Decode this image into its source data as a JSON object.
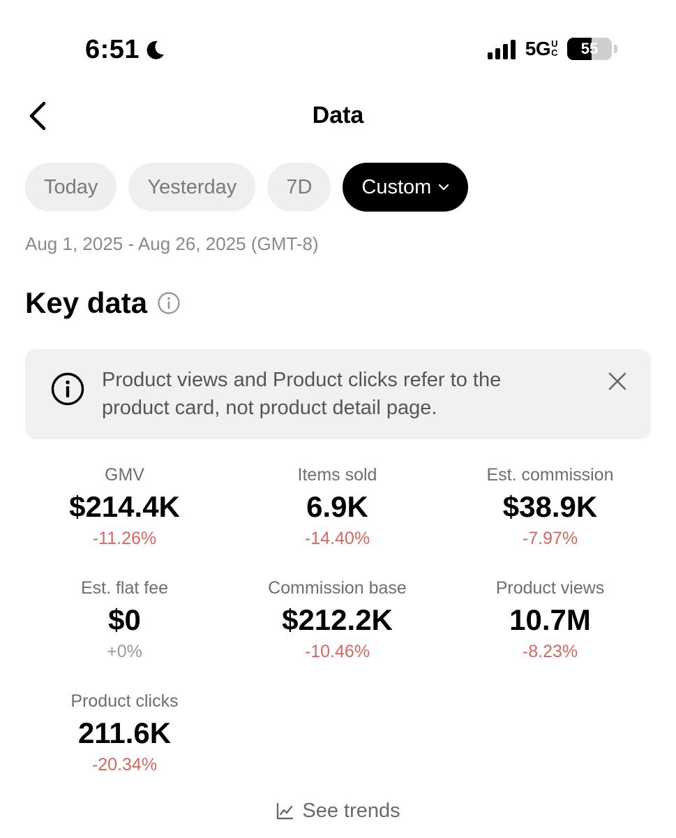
{
  "status_bar": {
    "time": "6:51",
    "network": "5G",
    "network_sup_1": "U",
    "network_sup_2": "C",
    "battery_level": "55",
    "battery_fraction": 0.55
  },
  "header": {
    "title": "Data"
  },
  "tabs": [
    {
      "label": "Today",
      "active": false
    },
    {
      "label": "Yesterday",
      "active": false
    },
    {
      "label": "7D",
      "active": false
    },
    {
      "label": "Custom",
      "active": true
    }
  ],
  "date_range": "Aug 1, 2025 - Aug 26, 2025 (GMT-8)",
  "section": {
    "title": "Key data"
  },
  "banner": {
    "line1": "Product views and Product clicks refer to the",
    "line2": "product card, not product detail page."
  },
  "metrics": [
    {
      "label": "GMV",
      "value": "$214.4K",
      "delta": "-11.26%"
    },
    {
      "label": "Items sold",
      "value": "6.9K",
      "delta": "-14.40%"
    },
    {
      "label": "Est. commission",
      "value": "$38.9K",
      "delta": "-7.97%"
    },
    {
      "label": "Est. flat fee",
      "value": "$0",
      "delta": "+0%"
    },
    {
      "label": "Commission base",
      "value": "$212.2K",
      "delta": "-10.46%"
    },
    {
      "label": "Product views",
      "value": "10.7M",
      "delta": "-8.23%"
    },
    {
      "label": "Product clicks",
      "value": "211.6K",
      "delta": "-20.34%"
    }
  ],
  "footer": {
    "see_trends": "See trends"
  },
  "colors": {
    "negative_delta": "#d9675d",
    "neutral_delta": "#9b9b9b",
    "active_tab_bg": "#000000",
    "tab_bg": "#efefef"
  }
}
